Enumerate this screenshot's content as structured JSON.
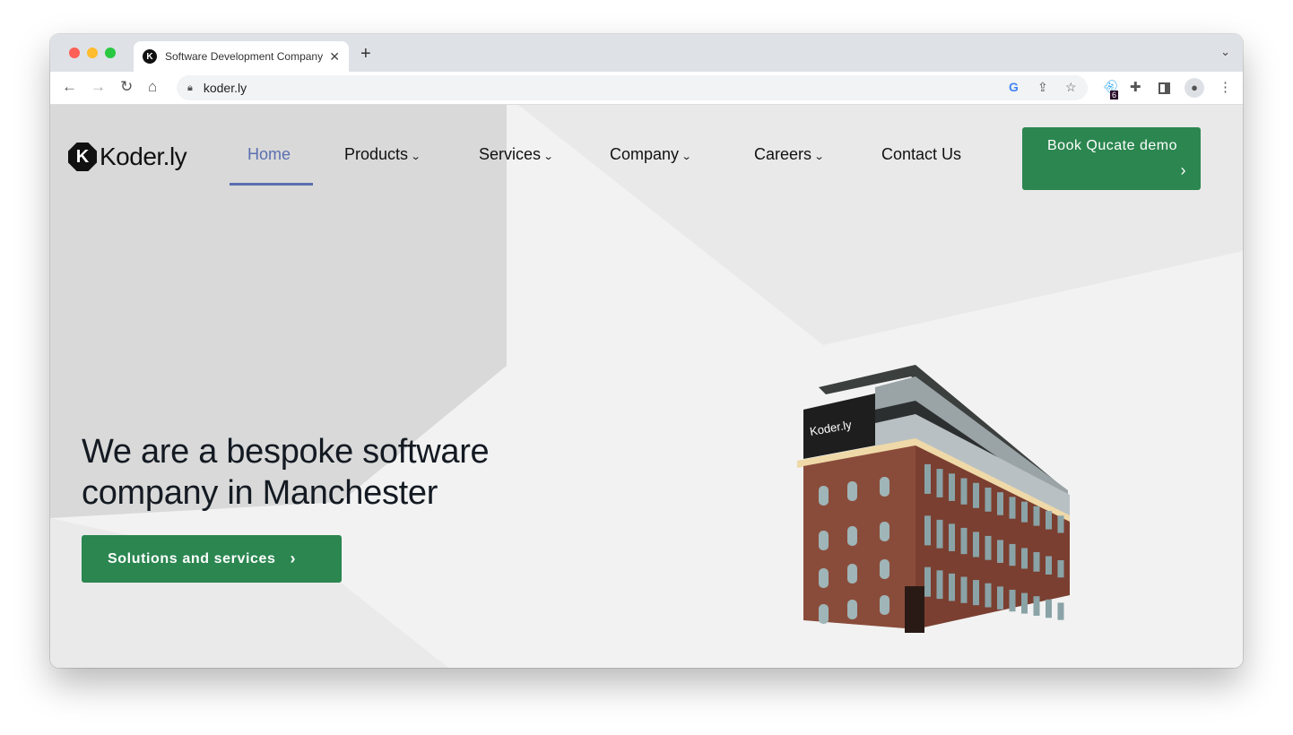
{
  "browser": {
    "tab_title": "Software Development Company",
    "tab_favicon": "K",
    "url": "koder.ly",
    "extension_badge": "6",
    "icons": [
      "back-icon",
      "forward-icon",
      "reload-icon",
      "home-icon",
      "lock-icon",
      "google-icon",
      "share-icon",
      "star-icon",
      "ghost-extension-icon",
      "puzzle-icon",
      "sidepanel-icon",
      "profile-icon",
      "kebab-menu-icon"
    ]
  },
  "site": {
    "logo_text": "Koder.ly",
    "logo_mark": "K",
    "nav": [
      {
        "label": "Home",
        "active": true
      },
      {
        "label": "Products",
        "dropdown": true
      },
      {
        "label": "Services",
        "dropdown": true
      },
      {
        "label": "Company",
        "dropdown": true
      },
      {
        "label": "Careers",
        "dropdown": true
      },
      {
        "label": "Contact Us"
      }
    ],
    "demo_button": "Book Qucate demo",
    "hero_line1": "We are a bespoke software",
    "hero_line2": "company in Manchester",
    "cta_button": "Solutions and services",
    "building_sign": "Koder.ly",
    "colors": {
      "accent_green": "#2b8650",
      "nav_active": "#5a6fb0",
      "brick": "#8a4c3a"
    }
  }
}
